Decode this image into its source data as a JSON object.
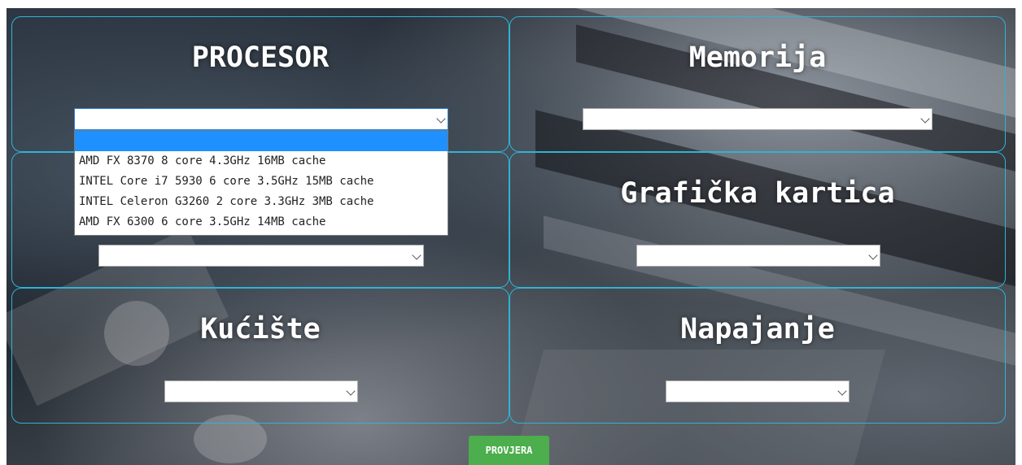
{
  "sections": {
    "procesor": {
      "title": "PROCESOR",
      "selected": ""
    },
    "memorija": {
      "title": "Memorija",
      "selected": ""
    },
    "maticna": {
      "title": "",
      "selected": ""
    },
    "graficka": {
      "title": "Grafička kartica",
      "selected": ""
    },
    "kuciste": {
      "title": "Kućište",
      "selected": ""
    },
    "napajanje": {
      "title": "Napajanje",
      "selected": ""
    }
  },
  "procesor_dropdown": {
    "options": [
      "",
      "AMD FX 8370 8 core 4.3GHz 16MB cache",
      "INTEL Core i7 5930 6 core 3.5GHz 15MB cache",
      "INTEL Celeron G3260 2 core 3.3GHz 3MB cache",
      "AMD FX 6300 6 core 3.5GHz 14MB cache"
    ],
    "highlighted_index": 0
  },
  "actions": {
    "check_label": "PROVJERA"
  },
  "colors": {
    "border": "#2fb3d6",
    "highlight": "#1e90ff",
    "button": "#4cae4c"
  }
}
